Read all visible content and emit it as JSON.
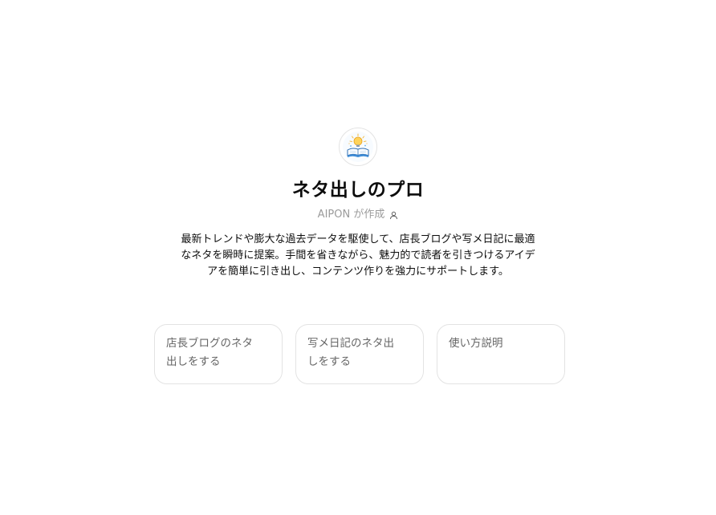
{
  "gpt": {
    "title": "ネタ出しのプロ",
    "author": "AIPON が作成",
    "description": "最新トレンドや膨大な過去データを駆使して、店長ブログや写メ日記に最適なネタを瞬時に提案。手間を省きながら、魅力的で読者を引きつけるアイデアを簡単に引き出し、コンテンツ作りを強力にサポートします。",
    "avatar_icon": "book-lightbulb-icon",
    "author_icon": "person-icon"
  },
  "starters": [
    {
      "label": "店長ブログのネタ出しをする"
    },
    {
      "label": "写メ日記のネタ出しをする"
    },
    {
      "label": "使い方説明"
    }
  ]
}
